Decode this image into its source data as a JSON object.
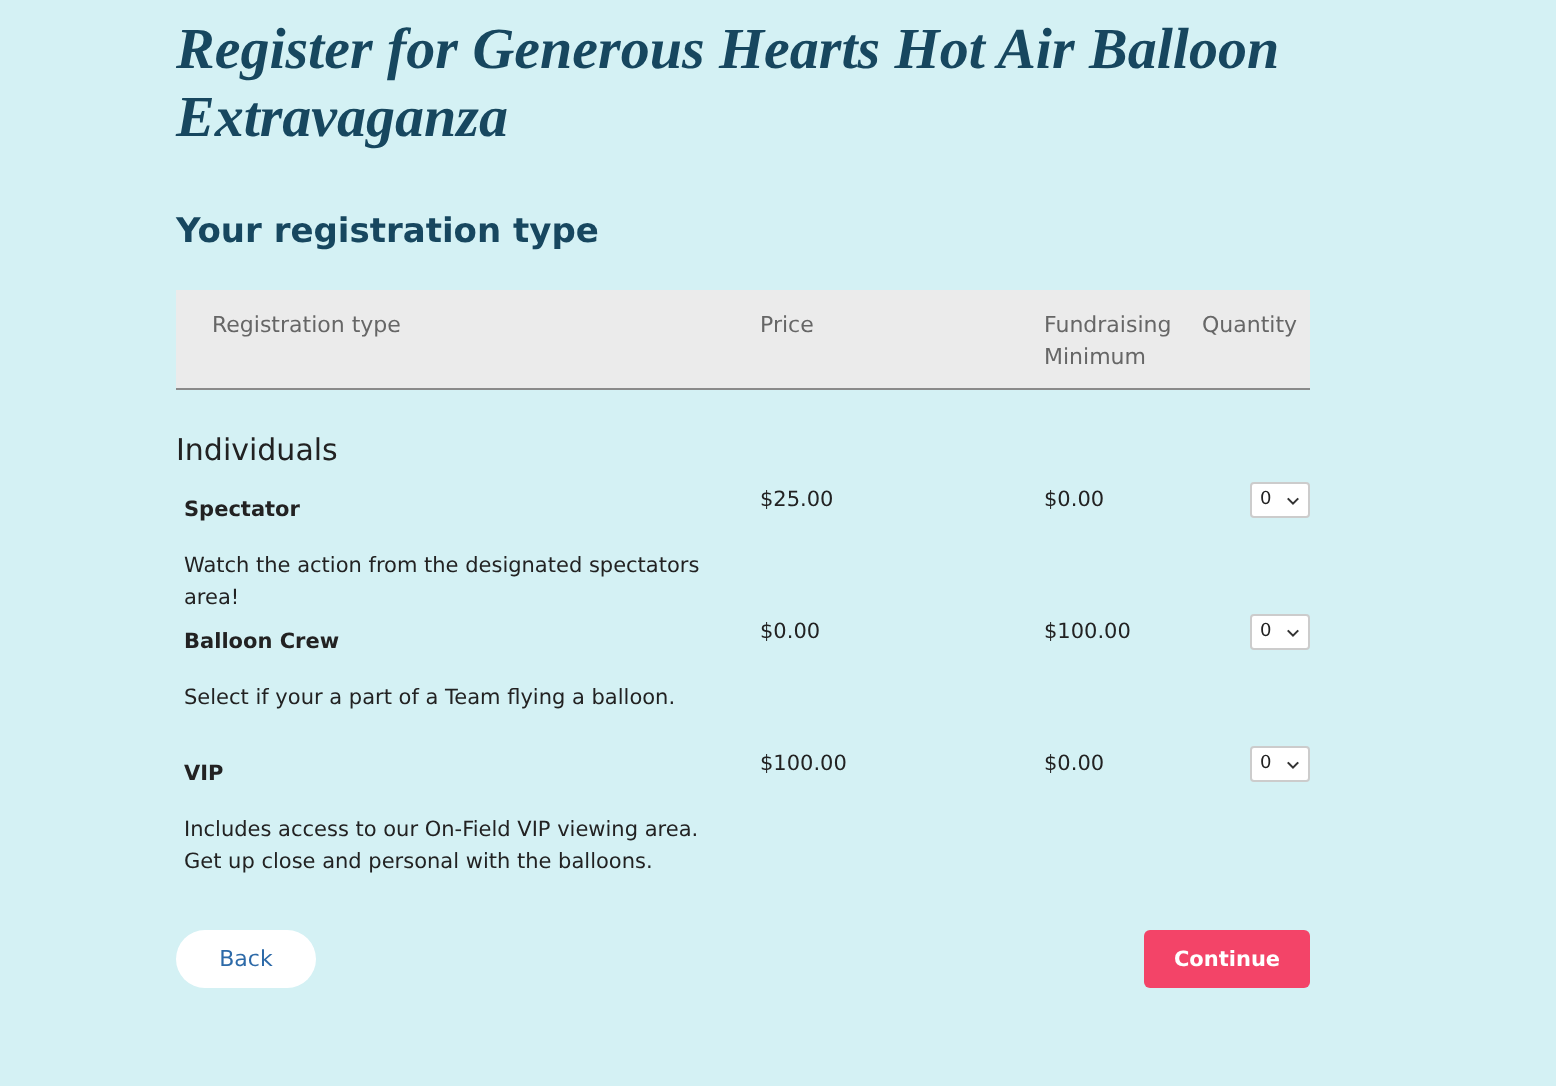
{
  "title": "Register for Generous Hearts Hot Air Balloon Extravaganza",
  "section_heading": "Your registration type",
  "table": {
    "columns": [
      "Registration type",
      "Price",
      "Fundraising Minimum",
      "Quantity"
    ],
    "group": "Individuals",
    "rows": [
      {
        "name": "Spectator",
        "price": "$25.00",
        "fundraising_minimum": "$0.00",
        "quantity": "0",
        "description": "Watch the action from the designated spectators area!"
      },
      {
        "name": "Balloon Crew",
        "price": "$0.00",
        "fundraising_minimum": "$100.00",
        "quantity": "0",
        "description": "Select if your a part of a Team flying a balloon."
      },
      {
        "name": "VIP",
        "price": "$100.00",
        "fundraising_minimum": "$0.00",
        "quantity": "0",
        "description": "Includes access to our On-Field VIP viewing area. Get up close and personal with the balloons."
      }
    ]
  },
  "buttons": {
    "back": "Back",
    "continue": "Continue"
  }
}
